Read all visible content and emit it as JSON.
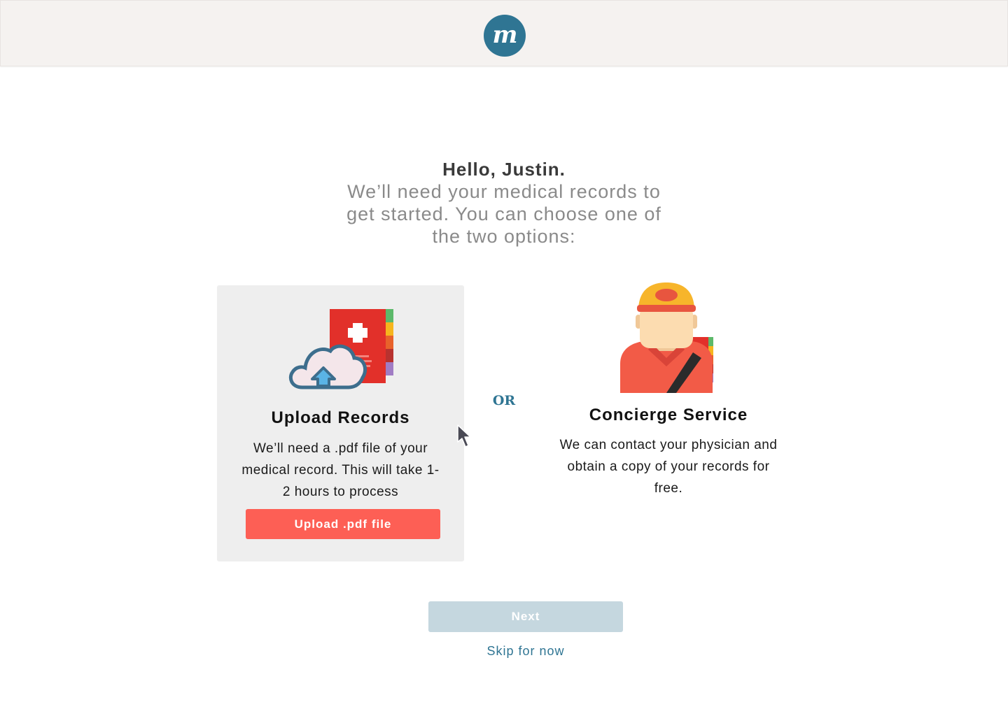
{
  "header": {
    "logo_text": "m",
    "logo_color": "#2f7593",
    "background": "#f5f2f0"
  },
  "intro": {
    "greeting": "Hello, Justin.",
    "subtitle": "We’ll need your medical records to get started. You can choose one of the two options:"
  },
  "options": {
    "upload": {
      "icon": "cloud-upload-records-icon",
      "title": "Upload Records",
      "description": "We’ll need a .pdf file of your medical record. This will take 1-2 hours to process",
      "button_label": "Upload .pdf file",
      "button_color": "#fd5f55"
    },
    "separator": "OR",
    "concierge": {
      "icon": "concierge-person-icon",
      "title": "Concierge Service",
      "description": "We can contact your physician and obtain a copy of your records for free."
    }
  },
  "footer": {
    "next_label": "Next",
    "next_color": "#c5d7df",
    "skip_label": "Skip for now"
  }
}
